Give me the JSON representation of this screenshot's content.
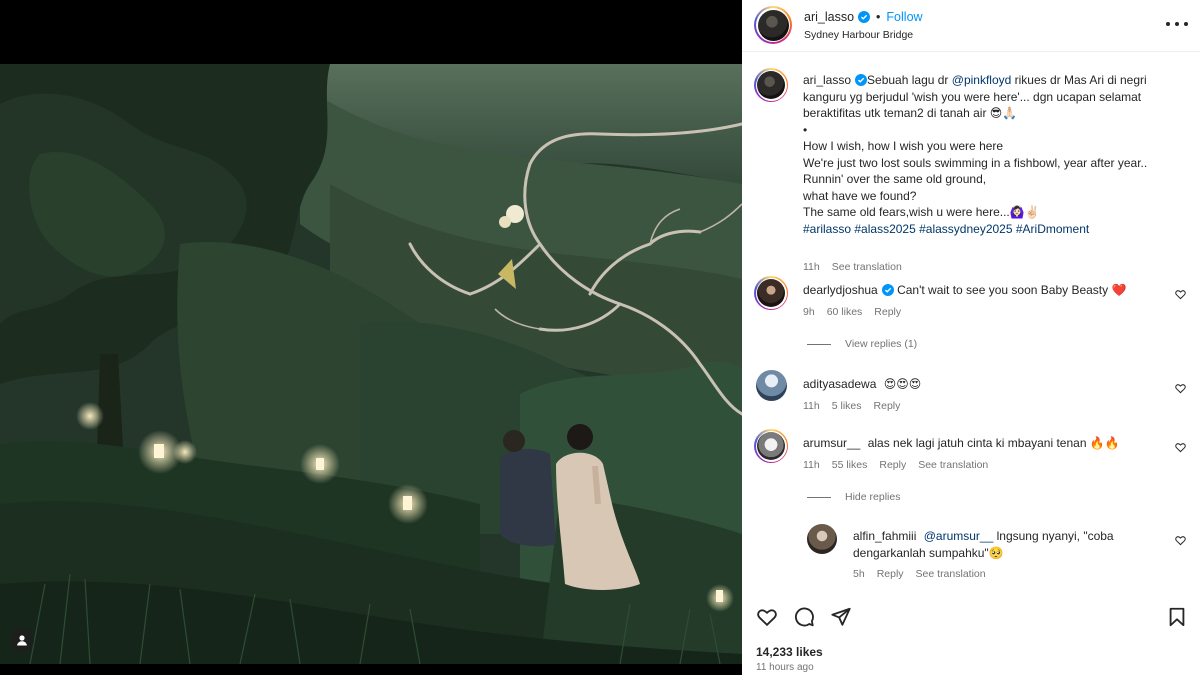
{
  "post": {
    "username": "ari_lasso",
    "follow_label": "Follow",
    "separator": "•",
    "location": "Sydney Harbour Bridge"
  },
  "caption": {
    "username": "ari_lasso",
    "text_1": "Sebuah lagu dr ",
    "mention": "@pinkfloyd",
    "text_2": " rikues dr Mas Ari di negri kanguru yg berjudul 'wish you were here'... dgn ucapan selamat beraktifitas utk teman2 di tanah air 😎🙏🏻",
    "bullet": "•",
    "lyrics": [
      "How I wish, how I wish you were here",
      "We're just two lost souls swimming in a fishbowl, year after year..",
      "Runnin' over the same old ground,",
      "what have we found?",
      "The same old fears,wish u were here...🙆🏻‍♀️✌🏻"
    ],
    "hashtags": [
      "#arilasso",
      "#alass2025",
      "#alassydney2025",
      "#AriDmoment"
    ],
    "time": "11h",
    "see_translation": "See translation"
  },
  "comments": [
    {
      "username": "dearlydjoshua",
      "verified": true,
      "text": "Can't wait to see you soon Baby Beasty ❤️",
      "time": "9h",
      "likes": "60 likes",
      "reply": "Reply",
      "replies_toggle": "View replies (1)"
    },
    {
      "username": "adityasadewa",
      "text": "😍😍😍",
      "time": "11h",
      "likes": "5 likes",
      "reply": "Reply"
    },
    {
      "username": "arumsur__",
      "text": "alas nek lagi jatuh cinta ki mbayani tenan 🔥🔥",
      "time": "11h",
      "likes": "55 likes",
      "reply": "Reply",
      "see_translation": "See translation",
      "replies_toggle": "Hide replies"
    }
  ],
  "reply": {
    "username": "alfin_fahmiii",
    "mention": "@arumsur__",
    "text": " lngsung nyanyi, \"coba dengarkanlah sumpahku\"🥺",
    "time": "5h",
    "reply": "Reply",
    "see_translation": "See translation"
  },
  "footer": {
    "likes": "14,233 likes",
    "time_ago": "11 hours ago"
  },
  "icons": {
    "verified": "verified-badge-icon",
    "more": "more-options-icon",
    "heart": "heart-icon",
    "comment": "comment-icon",
    "share": "share-icon",
    "save": "bookmark-icon",
    "tag": "user-tag-icon"
  },
  "colors": {
    "follow": "#0095f6",
    "verified": "#0095f6",
    "mention": "#00376b",
    "meta": "#737373",
    "text": "#262626"
  }
}
